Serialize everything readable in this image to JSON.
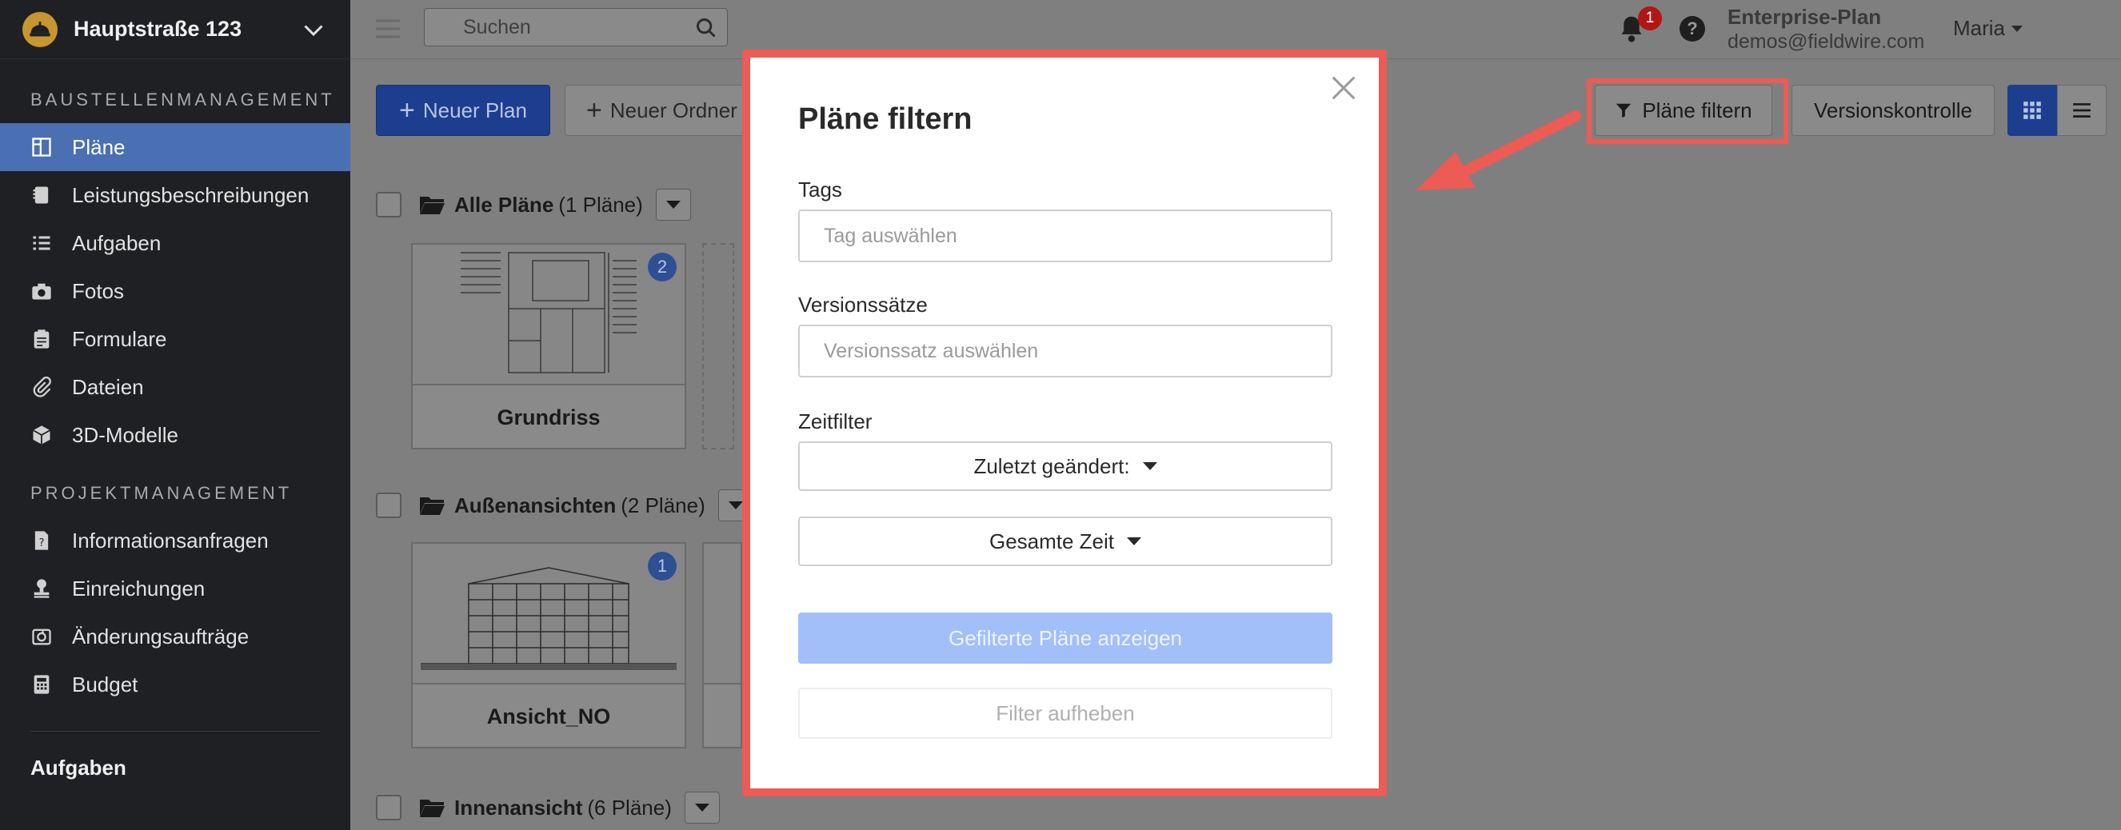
{
  "sidebar": {
    "project": "Hauptstraße 123",
    "section1": "BAUSTELLENMANAGEMENT",
    "items1": [
      {
        "label": "Pläne",
        "icon": "plans-icon",
        "active": true
      },
      {
        "label": "Leistungsbeschreibungen",
        "icon": "notebook-icon"
      },
      {
        "label": "Aufgaben",
        "icon": "list-icon"
      },
      {
        "label": "Fotos",
        "icon": "camera-icon"
      },
      {
        "label": "Formulare",
        "icon": "clipboard-icon"
      },
      {
        "label": "Dateien",
        "icon": "paperclip-icon"
      },
      {
        "label": "3D-Modelle",
        "icon": "cube-icon"
      }
    ],
    "section2": "PROJEKTMANAGEMENT",
    "items2": [
      {
        "label": "Informationsanfragen",
        "icon": "document-question-icon"
      },
      {
        "label": "Einreichungen",
        "icon": "stamp-icon"
      },
      {
        "label": "Änderungsaufträge",
        "icon": "change-order-icon"
      },
      {
        "label": "Budget",
        "icon": "calculator-icon"
      }
    ],
    "bottom": "Aufgaben"
  },
  "topbar": {
    "search_placeholder": "Suchen",
    "notification_count": "1",
    "help": "?",
    "plan_name": "Enterprise-Plan",
    "plan_email": "demos@fieldwire.com",
    "user": "Maria"
  },
  "toolbar": {
    "new_plan": "Neuer Plan",
    "new_folder": "Neuer Ordner",
    "filter": "Pläne filtern",
    "version": "Versionskontrolle"
  },
  "folders": [
    {
      "name": "Alle Pläne",
      "count": "(1 Pläne)",
      "cards": [
        {
          "title": "Grundriss",
          "num": "2"
        }
      ]
    },
    {
      "name": "Außenansichten",
      "count": "(2 Pläne)",
      "cards": [
        {
          "title": "Ansicht_NO",
          "num": "1"
        }
      ]
    },
    {
      "name": "Innenansicht",
      "count": "(6 Pläne)",
      "cards": []
    }
  ],
  "modal": {
    "title": "Pläne filtern",
    "tags_label": "Tags",
    "tags_placeholder": "Tag auswählen",
    "versions_label": "Versionssätze",
    "versions_placeholder": "Versionssatz auswählen",
    "time_label": "Zeitfilter",
    "time_select1": "Zuletzt geändert:",
    "time_select2": "Gesamte Zeit",
    "show_button": "Gefilterte Pläne anzeigen",
    "clear_button": "Filter aufheben"
  },
  "colors": {
    "accent": "#1d3e8f",
    "highlight": "#ec5b54",
    "sidebar_active": "#4a6fb3"
  }
}
